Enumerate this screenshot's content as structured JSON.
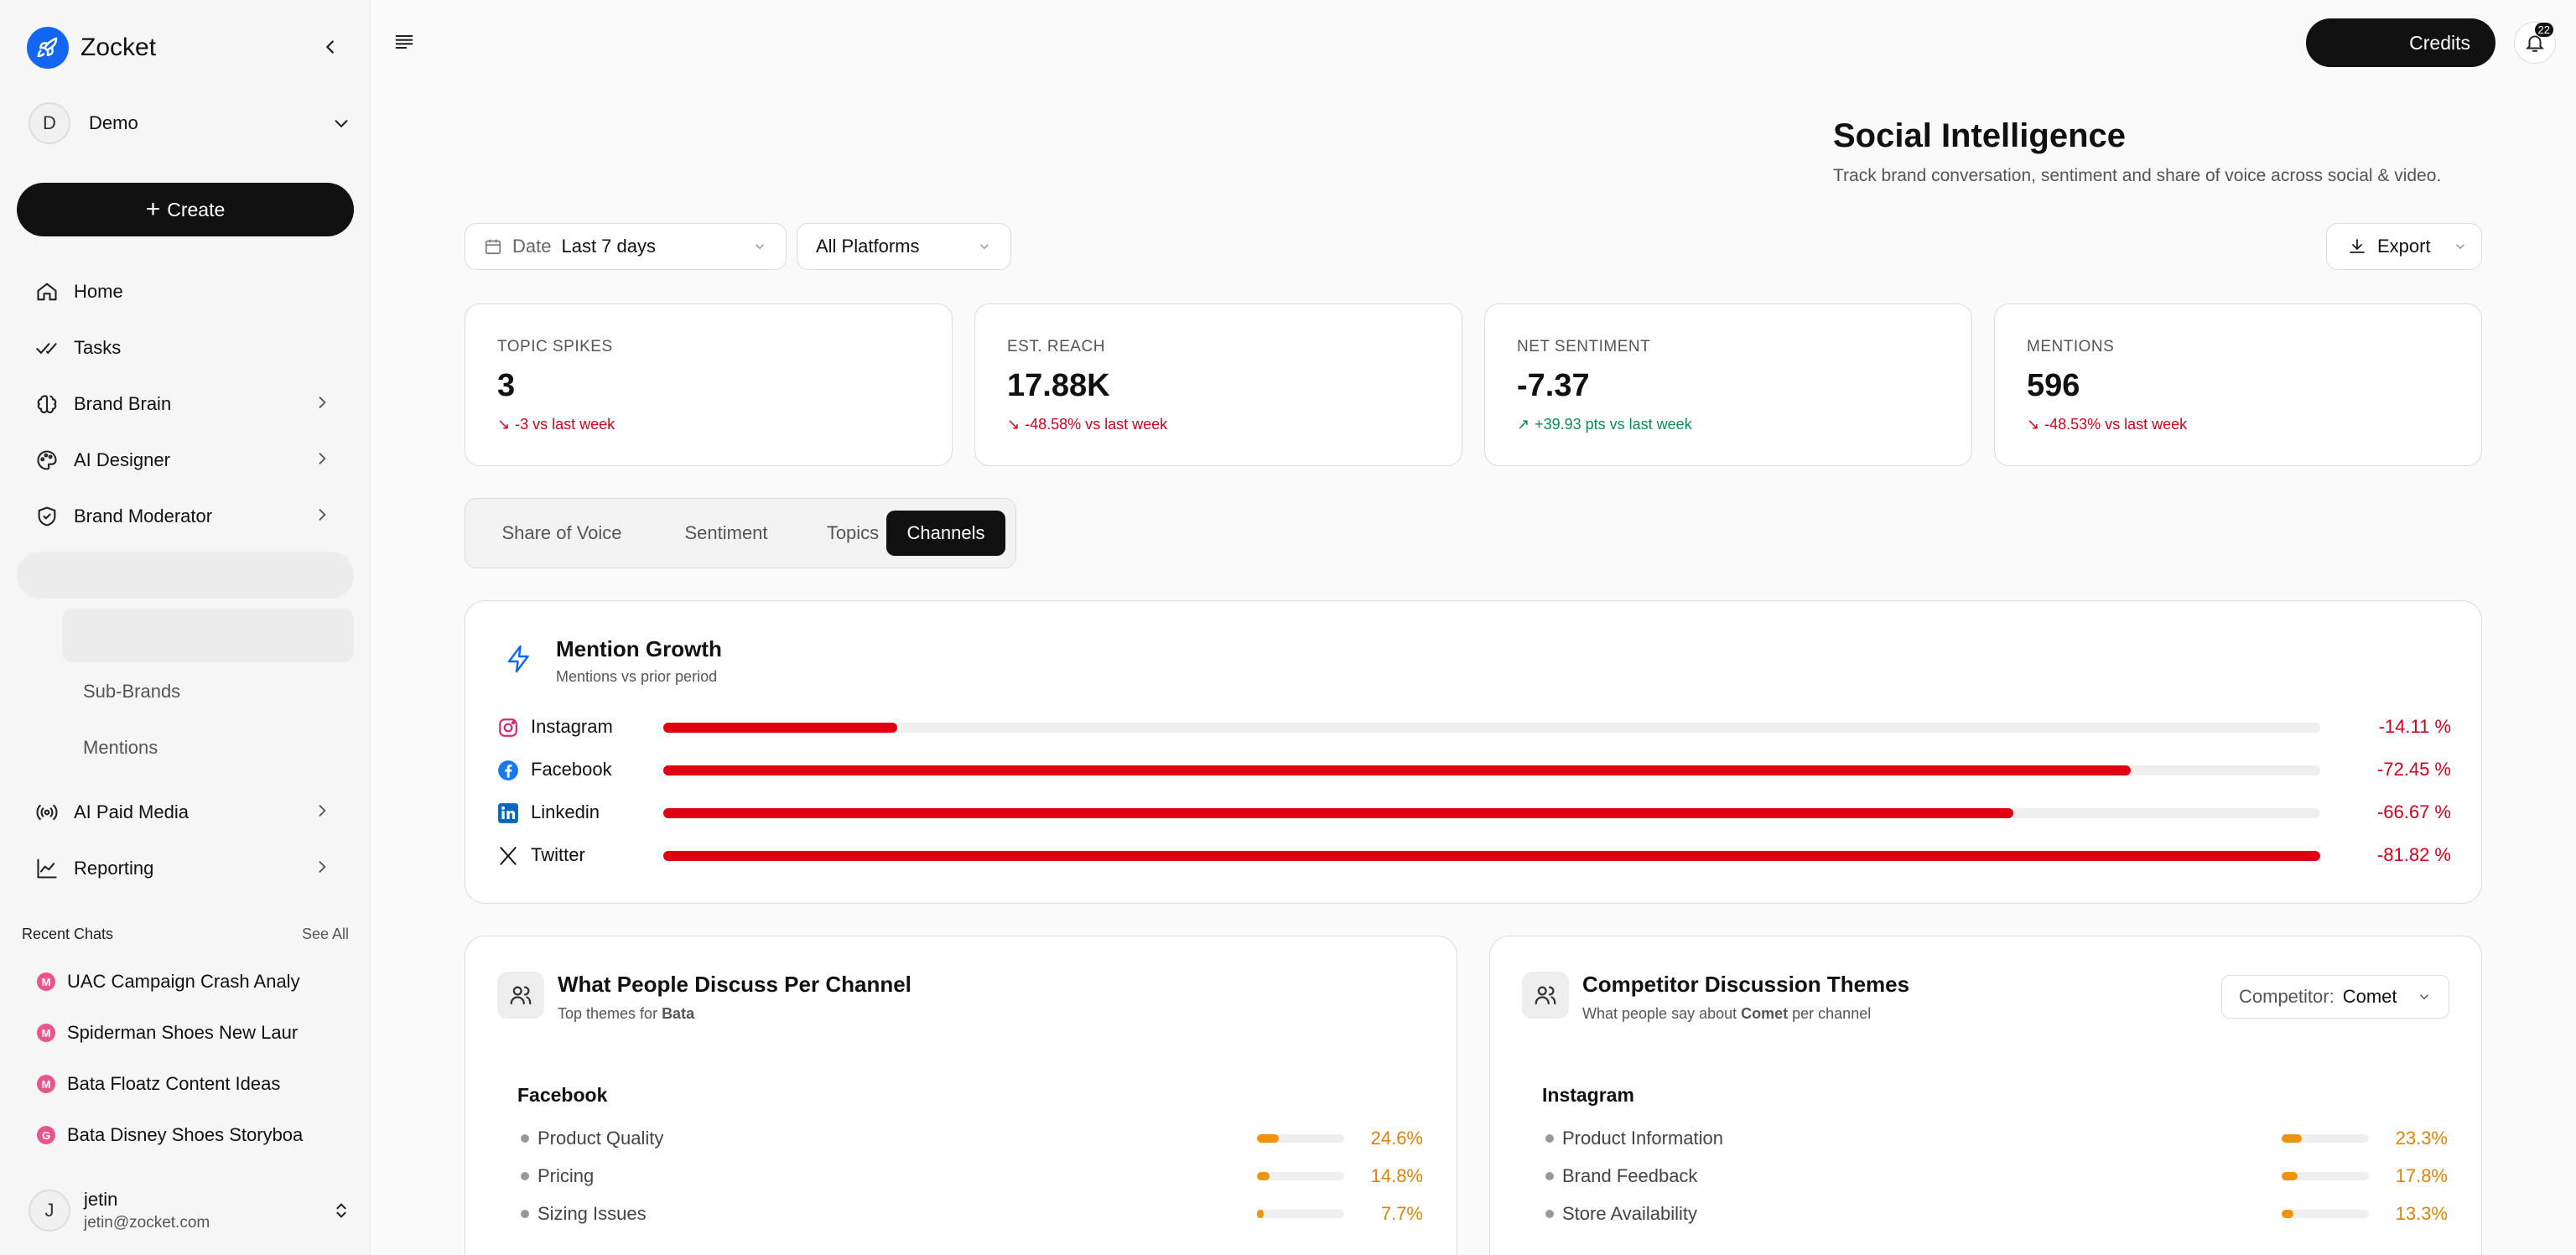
{
  "app": {
    "name": "Zocket"
  },
  "workspace": {
    "initial": "D",
    "name": "Demo"
  },
  "create_label": "Create",
  "nav": {
    "home": "Home",
    "tasks": "Tasks",
    "brand_brain": "Brand Brain",
    "ai_designer": "AI Designer",
    "brand_moderator": "Brand Moderator",
    "sub_brands": "Sub-Brands",
    "mentions": "Mentions",
    "ai_paid_media": "AI Paid Media",
    "reporting": "Reporting"
  },
  "recent": {
    "title": "Recent Chats",
    "see_all": "See All",
    "chats": [
      {
        "badge": "M",
        "title": "UAC Campaign Crash Analy"
      },
      {
        "badge": "M",
        "title": "Spiderman Shoes New Laur"
      },
      {
        "badge": "M",
        "title": "Bata Floatz Content Ideas"
      },
      {
        "badge": "G",
        "title": "Bata Disney Shoes Storyboa"
      }
    ]
  },
  "user": {
    "initial": "J",
    "name": "jetin",
    "email": "jetin@zocket.com"
  },
  "topbar": {
    "credits": "Credits",
    "notifications": "22"
  },
  "page": {
    "title": "Social Intelligence",
    "subtitle": "Track brand conversation, sentiment and share of voice across social & video."
  },
  "filters": {
    "date_label": "Date",
    "date_value": "Last 7 days",
    "platform": "All Platforms",
    "export": "Export"
  },
  "kpis": [
    {
      "label": "TOPIC SPIKES",
      "value": "3",
      "delta": "-3 vs last week",
      "direction": "down"
    },
    {
      "label": "EST. REACH",
      "value": "17.88K",
      "delta": "-48.58% vs last week",
      "direction": "down"
    },
    {
      "label": "NET SENTIMENT",
      "value": "-7.37",
      "delta": "+39.93 pts vs last week",
      "direction": "up"
    },
    {
      "label": "MENTIONS",
      "value": "596",
      "delta": "-48.53% vs last week",
      "direction": "down"
    }
  ],
  "tabs": [
    "Share of Voice",
    "Sentiment",
    "Topics",
    "Channels"
  ],
  "active_tab": "Channels",
  "mention_growth": {
    "title": "Mention Growth",
    "subtitle": "Mentions vs prior period",
    "rows": [
      {
        "channel": "Instagram",
        "icon": "instagram-icon",
        "pct": "-14.11 %",
        "level": 0.1411
      },
      {
        "channel": "Facebook",
        "icon": "facebook-icon",
        "pct": "-72.45 %",
        "level": 0.8855
      },
      {
        "channel": "Linkedin",
        "icon": "linkedin-icon",
        "pct": "-66.67 %",
        "level": 0.8148
      },
      {
        "channel": "Twitter",
        "icon": "twitter-x-icon",
        "pct": "-81.82 %",
        "level": 1.0
      }
    ]
  },
  "discuss": {
    "title": "What People Discuss Per Channel",
    "subtitle_prefix": "Top themes for ",
    "subtitle_brand": "Bata",
    "channel": "Facebook",
    "themes": [
      {
        "label": "Product Quality",
        "pct": "24.6%",
        "level": 0.246
      },
      {
        "label": "Pricing",
        "pct": "14.8%",
        "level": 0.148
      },
      {
        "label": "Sizing Issues",
        "pct": "7.7%",
        "level": 0.077
      }
    ]
  },
  "competitor": {
    "title": "Competitor Discussion Themes",
    "subtitle_prefix": "What people say about ",
    "subtitle_brand": "Comet",
    "subtitle_suffix": " per channel",
    "select_label": "Competitor:",
    "select_value": "Comet",
    "channel": "Instagram",
    "themes": [
      {
        "label": "Product Information",
        "pct": "23.3%",
        "level": 0.233
      },
      {
        "label": "Brand Feedback",
        "pct": "17.8%",
        "level": 0.178
      },
      {
        "label": "Store Availability",
        "pct": "13.3%",
        "level": 0.133
      }
    ]
  },
  "colors": {
    "negative": "#d6001c",
    "positive": "#0c8c55",
    "bar": "#e0000f",
    "theme_bar": "#f0930c",
    "brand": "#1266f1"
  }
}
